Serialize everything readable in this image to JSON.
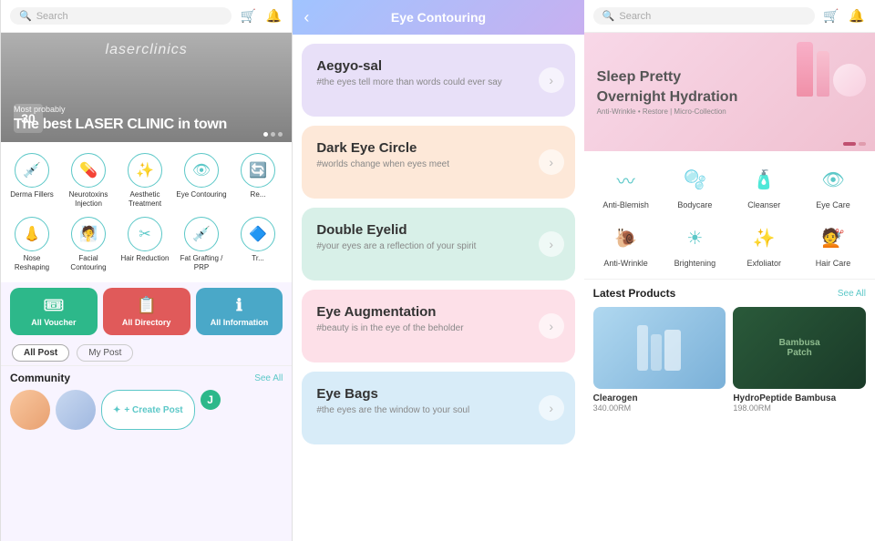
{
  "panel1": {
    "topbar": {
      "search_placeholder": "Search",
      "cart_icon": "🛒",
      "bell_icon": "🔔"
    },
    "hero": {
      "sub_text": "Most probably",
      "title": "The best LASER CLINIC in town",
      "badge_text": "30",
      "dots": [
        true,
        false,
        false
      ]
    },
    "categories": [
      {
        "icon": "💉",
        "label": "Derma Fillers"
      },
      {
        "icon": "💊",
        "label": "Neurotoxins Injection"
      },
      {
        "icon": "✨",
        "label": "Aesthetic Treatment"
      },
      {
        "icon": "👁",
        "label": "Eye Contouring"
      },
      {
        "icon": "🔄",
        "label": "Re..."
      },
      {
        "icon": "👃",
        "label": "Nose Reshaping"
      },
      {
        "icon": "🧖",
        "label": "Facial Contouring"
      },
      {
        "icon": "✂",
        "label": "Hair Reduction"
      },
      {
        "icon": "💉",
        "label": "Fat Grafting / PRP"
      },
      {
        "icon": "🔷",
        "label": "Tr..."
      }
    ],
    "buttons": [
      {
        "label": "All Voucher",
        "icon": "🎟",
        "color": "btn-green"
      },
      {
        "label": "All Directory",
        "icon": "📋",
        "color": "btn-red"
      },
      {
        "label": "All Information",
        "icon": "ℹ",
        "color": "btn-blue"
      }
    ],
    "tabs": [
      {
        "label": "All Post",
        "active": true
      },
      {
        "label": "My Post",
        "active": false
      }
    ],
    "community": {
      "title": "Community",
      "see_all": "See All",
      "create_post_label": "+ Create Post"
    }
  },
  "panel2": {
    "header_title": "Eye Contouring",
    "back_icon": "‹",
    "cards": [
      {
        "title": "Aegyo-sal",
        "subtitle": "#the eyes tell more than words could ever say",
        "color": "purple"
      },
      {
        "title": "Dark Eye Circle",
        "subtitle": "#worlds change when eyes meet",
        "color": "orange"
      },
      {
        "title": "Double Eyelid",
        "subtitle": "#your eyes are a reflection of your spirit",
        "color": "green"
      },
      {
        "title": "Eye Augmentation",
        "subtitle": "#beauty is in the eye of the beholder",
        "color": "pink"
      },
      {
        "title": "Eye Bags",
        "subtitle": "#the eyes are the window to your soul",
        "color": "blue"
      }
    ]
  },
  "panel3": {
    "topbar": {
      "search_placeholder": "Search",
      "cart_icon": "🛒",
      "bell_icon": "🔔"
    },
    "hero": {
      "title_line1": "Sleep Pretty",
      "title_line2": "Overnight Hydration",
      "subtitle": "Anti-Wrinkle • Restore | Micro-Collection",
      "dots": [
        true,
        false
      ]
    },
    "categories": [
      {
        "icon": "〰",
        "label": "Anti-Blemish"
      },
      {
        "icon": "🫧",
        "label": "Bodycare"
      },
      {
        "icon": "🧴",
        "label": "Cleanser"
      },
      {
        "icon": "👁",
        "label": "Eye Care"
      },
      {
        "icon": "🐌",
        "label": "Anti-Wrinkle"
      },
      {
        "icon": "☀",
        "label": "Brightening"
      },
      {
        "icon": "✨",
        "label": "Exfoliator"
      },
      {
        "icon": "💇",
        "label": "Hair Care"
      }
    ],
    "latest": {
      "title": "Latest Products",
      "see_all": "See All",
      "products": [
        {
          "name": "Clearogen",
          "price": "340.00RM",
          "img_style": "blue-bg"
        },
        {
          "name": "HydroPeptide Bambusa",
          "price": "198.00RM",
          "img_style": "green-bg"
        }
      ]
    }
  }
}
